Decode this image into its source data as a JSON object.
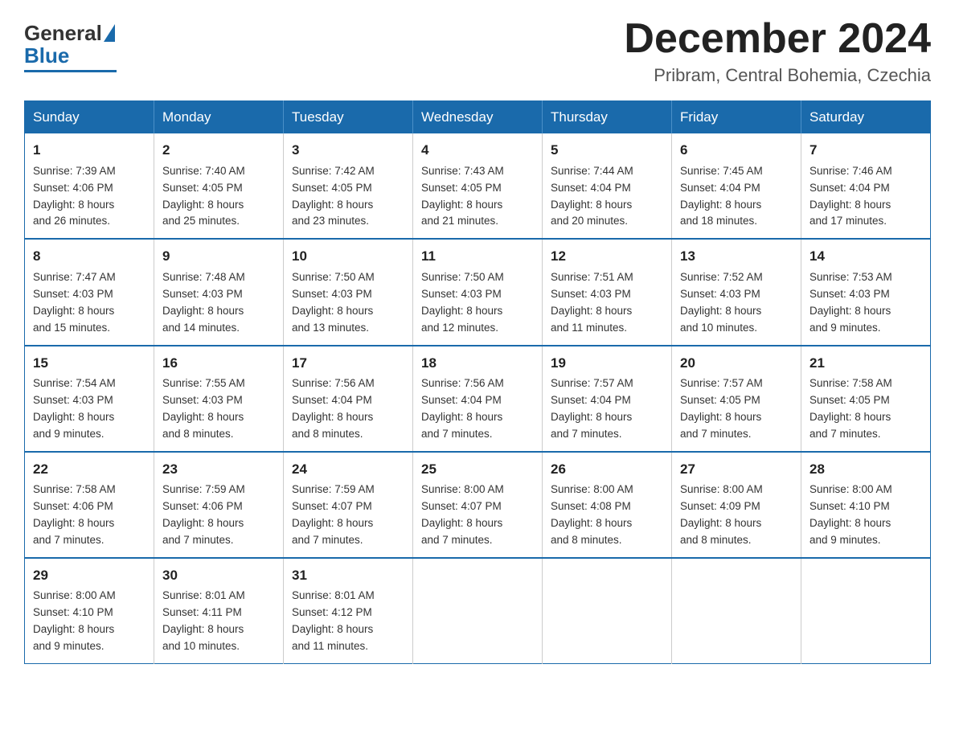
{
  "header": {
    "logo": {
      "general": "General",
      "blue": "Blue"
    },
    "title": "December 2024",
    "location": "Pribram, Central Bohemia, Czechia"
  },
  "calendar": {
    "days_of_week": [
      "Sunday",
      "Monday",
      "Tuesday",
      "Wednesday",
      "Thursday",
      "Friday",
      "Saturday"
    ],
    "weeks": [
      [
        {
          "day": "1",
          "sunrise": "7:39 AM",
          "sunset": "4:06 PM",
          "daylight": "8 hours and 26 minutes."
        },
        {
          "day": "2",
          "sunrise": "7:40 AM",
          "sunset": "4:05 PM",
          "daylight": "8 hours and 25 minutes."
        },
        {
          "day": "3",
          "sunrise": "7:42 AM",
          "sunset": "4:05 PM",
          "daylight": "8 hours and 23 minutes."
        },
        {
          "day": "4",
          "sunrise": "7:43 AM",
          "sunset": "4:05 PM",
          "daylight": "8 hours and 21 minutes."
        },
        {
          "day": "5",
          "sunrise": "7:44 AM",
          "sunset": "4:04 PM",
          "daylight": "8 hours and 20 minutes."
        },
        {
          "day": "6",
          "sunrise": "7:45 AM",
          "sunset": "4:04 PM",
          "daylight": "8 hours and 18 minutes."
        },
        {
          "day": "7",
          "sunrise": "7:46 AM",
          "sunset": "4:04 PM",
          "daylight": "8 hours and 17 minutes."
        }
      ],
      [
        {
          "day": "8",
          "sunrise": "7:47 AM",
          "sunset": "4:03 PM",
          "daylight": "8 hours and 15 minutes."
        },
        {
          "day": "9",
          "sunrise": "7:48 AM",
          "sunset": "4:03 PM",
          "daylight": "8 hours and 14 minutes."
        },
        {
          "day": "10",
          "sunrise": "7:50 AM",
          "sunset": "4:03 PM",
          "daylight": "8 hours and 13 minutes."
        },
        {
          "day": "11",
          "sunrise": "7:50 AM",
          "sunset": "4:03 PM",
          "daylight": "8 hours and 12 minutes."
        },
        {
          "day": "12",
          "sunrise": "7:51 AM",
          "sunset": "4:03 PM",
          "daylight": "8 hours and 11 minutes."
        },
        {
          "day": "13",
          "sunrise": "7:52 AM",
          "sunset": "4:03 PM",
          "daylight": "8 hours and 10 minutes."
        },
        {
          "day": "14",
          "sunrise": "7:53 AM",
          "sunset": "4:03 PM",
          "daylight": "8 hours and 9 minutes."
        }
      ],
      [
        {
          "day": "15",
          "sunrise": "7:54 AM",
          "sunset": "4:03 PM",
          "daylight": "8 hours and 9 minutes."
        },
        {
          "day": "16",
          "sunrise": "7:55 AM",
          "sunset": "4:03 PM",
          "daylight": "8 hours and 8 minutes."
        },
        {
          "day": "17",
          "sunrise": "7:56 AM",
          "sunset": "4:04 PM",
          "daylight": "8 hours and 8 minutes."
        },
        {
          "day": "18",
          "sunrise": "7:56 AM",
          "sunset": "4:04 PM",
          "daylight": "8 hours and 7 minutes."
        },
        {
          "day": "19",
          "sunrise": "7:57 AM",
          "sunset": "4:04 PM",
          "daylight": "8 hours and 7 minutes."
        },
        {
          "day": "20",
          "sunrise": "7:57 AM",
          "sunset": "4:05 PM",
          "daylight": "8 hours and 7 minutes."
        },
        {
          "day": "21",
          "sunrise": "7:58 AM",
          "sunset": "4:05 PM",
          "daylight": "8 hours and 7 minutes."
        }
      ],
      [
        {
          "day": "22",
          "sunrise": "7:58 AM",
          "sunset": "4:06 PM",
          "daylight": "8 hours and 7 minutes."
        },
        {
          "day": "23",
          "sunrise": "7:59 AM",
          "sunset": "4:06 PM",
          "daylight": "8 hours and 7 minutes."
        },
        {
          "day": "24",
          "sunrise": "7:59 AM",
          "sunset": "4:07 PM",
          "daylight": "8 hours and 7 minutes."
        },
        {
          "day": "25",
          "sunrise": "8:00 AM",
          "sunset": "4:07 PM",
          "daylight": "8 hours and 7 minutes."
        },
        {
          "day": "26",
          "sunrise": "8:00 AM",
          "sunset": "4:08 PM",
          "daylight": "8 hours and 8 minutes."
        },
        {
          "day": "27",
          "sunrise": "8:00 AM",
          "sunset": "4:09 PM",
          "daylight": "8 hours and 8 minutes."
        },
        {
          "day": "28",
          "sunrise": "8:00 AM",
          "sunset": "4:10 PM",
          "daylight": "8 hours and 9 minutes."
        }
      ],
      [
        {
          "day": "29",
          "sunrise": "8:00 AM",
          "sunset": "4:10 PM",
          "daylight": "8 hours and 9 minutes."
        },
        {
          "day": "30",
          "sunrise": "8:01 AM",
          "sunset": "4:11 PM",
          "daylight": "8 hours and 10 minutes."
        },
        {
          "day": "31",
          "sunrise": "8:01 AM",
          "sunset": "4:12 PM",
          "daylight": "8 hours and 11 minutes."
        },
        null,
        null,
        null,
        null
      ]
    ]
  },
  "labels": {
    "sunrise": "Sunrise:",
    "sunset": "Sunset:",
    "daylight": "Daylight:"
  }
}
